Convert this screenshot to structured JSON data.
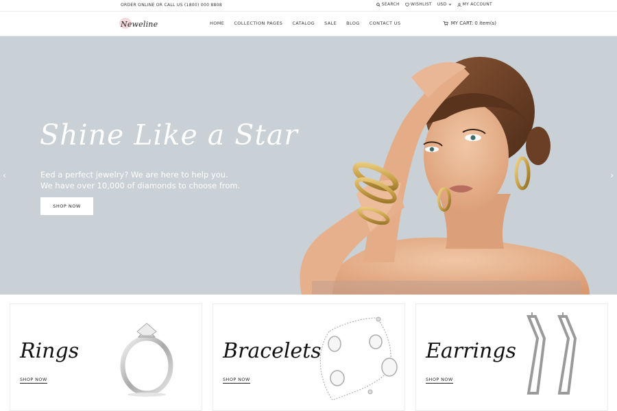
{
  "topbar": {
    "order_text": "ORDER ONLINE OR CALL US (1800) 000 8808",
    "search": "SEARCH",
    "wishlist": "WISHLIST",
    "currency": "USD",
    "account": "MY ACCOUNT"
  },
  "header": {
    "logo": "Neweline",
    "nav": [
      "HOME",
      "COLLECTION PAGES",
      "CATALOG",
      "SALE",
      "BLOG",
      "CONTACT US"
    ],
    "cart": "MY CART: 0 item(s)"
  },
  "hero": {
    "title": "Shine Like a Star",
    "subtitle_line1": "Eed a perfect jewelry? We are here to help you.",
    "subtitle_line2": "We have over 10,000 of diamonds to choose from.",
    "button": "SHOP NOW",
    "prev": "‹",
    "next": "›"
  },
  "collections": [
    {
      "title": "Rings",
      "link": "SHOP NOW"
    },
    {
      "title": "Bracelets",
      "link": "SHOP NOW"
    },
    {
      "title": "Earrings",
      "link": "SHOP NOW"
    }
  ],
  "colors": {
    "hero_bg": "#c9d1d6",
    "skin": "#e3b08f",
    "hair": "#6b3f26",
    "gold": "#c9a24a"
  },
  "icons": [
    "search-icon",
    "heart-icon",
    "chevron-down-icon",
    "user-icon",
    "cart-icon",
    "chevron-left-icon",
    "chevron-right-icon"
  ]
}
